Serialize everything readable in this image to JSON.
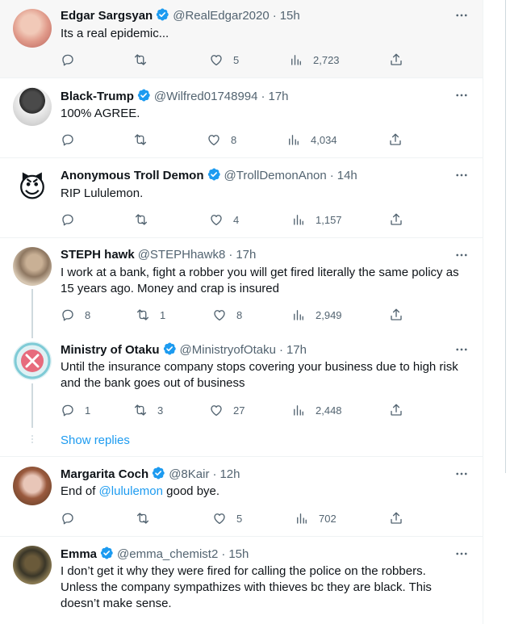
{
  "tweets": [
    {
      "name": "Edgar Sargsyan",
      "handle": "@RealEdgar2020",
      "time": "15h",
      "text": "Its a real epidemic...",
      "replies": "",
      "retweets": "",
      "likes": "5",
      "views": "2,723"
    },
    {
      "name": "Black-Trump",
      "handle": "@Wilfred01748994",
      "time": "17h",
      "text": "100% AGREE.",
      "replies": "",
      "retweets": "",
      "likes": "8",
      "views": "4,034"
    },
    {
      "name": "Anonymous Troll Demon",
      "handle": "@TrollDemonAnon",
      "time": "14h",
      "text": "RIP Lululemon.",
      "replies": "",
      "retweets": "",
      "likes": "4",
      "views": "1,157",
      "avatar_emoji": "😈"
    },
    {
      "name": "STEPH hawk",
      "handle": "@STEPHhawk8",
      "time": "17h",
      "text": "I work at a bank, fight a robber you will get fired literally the same policy as 15 years ago. Money and crap is insured",
      "replies": "8",
      "retweets": "1",
      "likes": "8",
      "views": "2,949"
    },
    {
      "name": "Ministry of Otaku",
      "handle": "@MinistryofOtaku",
      "time": "17h",
      "text": "Until the insurance company stops covering your business due to high risk and the bank goes out of business",
      "replies": "1",
      "retweets": "3",
      "likes": "27",
      "views": "2,448"
    },
    {
      "name": "Margarita Coch",
      "handle": "@8Kair",
      "time": "12h",
      "text_before": "End of ",
      "mention": "@lululemon",
      "text_after": " good bye.",
      "replies": "",
      "retweets": "",
      "likes": "5",
      "views": "702"
    },
    {
      "name": "Emma",
      "handle": "@emma_chemist2",
      "time": "15h",
      "text": "I don’t get it why they were fired for calling the police on the robbers. Unless the company sympathizes with thieves  bc they are black. This doesn’t make sense."
    }
  ],
  "show_replies_label": "Show replies",
  "separator": "·",
  "colors": {
    "accent": "#1d9bf0",
    "muted": "#536471",
    "text": "#0f1419",
    "border": "#eff3f4"
  },
  "icons": [
    "reply-icon",
    "retweet-icon",
    "like-icon",
    "views-icon",
    "share-icon",
    "more-icon",
    "verified-badge-icon"
  ]
}
